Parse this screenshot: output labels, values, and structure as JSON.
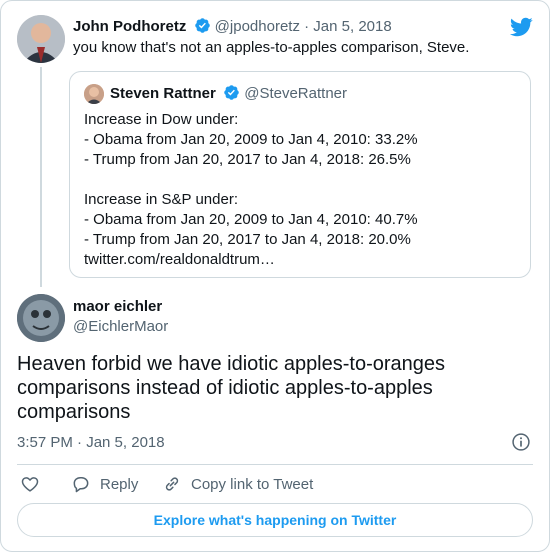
{
  "parent_tweet": {
    "author_name": "John Podhoretz",
    "handle": "@jpodhoretz",
    "separator": "·",
    "date": "Jan 5, 2018",
    "text": "you know that's not an apples-to-apples comparison, Steve."
  },
  "quoted_tweet": {
    "author_name": "Steven Rattner",
    "handle": "@SteveRattner",
    "lines": [
      "Increase in Dow under:",
      "- Obama from Jan 20, 2009 to Jan 4, 2010: 33.2%",
      "- Trump from Jan 20, 2017 to Jan 4, 2018: 26.5%",
      "",
      "Increase in S&P under:",
      "- Obama from Jan 20, 2009 to Jan 4, 2010: 40.7%",
      "- Trump from Jan 20, 2017 to Jan 4, 2018: 20.0%",
      "twitter.com/realdonaldtrum…"
    ]
  },
  "main_tweet": {
    "author_name": "maor eichler",
    "handle": "@EichlerMaor",
    "text_lines": [
      "Heaven forbid we have idiotic apples-to-oranges",
      "comparisons instead of idiotic apples-to-apples",
      "comparisons"
    ],
    "timestamp": "3:57 PM · Jan 5, 2018"
  },
  "actions": {
    "reply_label": "Reply",
    "copy_link_label": "Copy link to Tweet"
  },
  "explore_label": "Explore what's happening on Twitter",
  "icons": {
    "brand": "twitter-bird-icon",
    "verified": "verified-badge-icon",
    "like": "heart-icon",
    "reply": "reply-bubble-icon",
    "copy": "link-icon",
    "info": "info-icon"
  },
  "colors": {
    "accent": "#1d9bf0",
    "muted": "#536471",
    "border": "#cfd9de"
  }
}
